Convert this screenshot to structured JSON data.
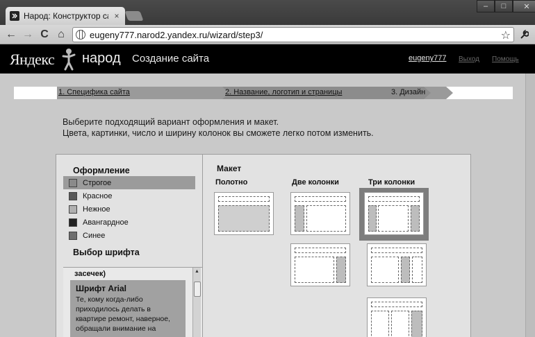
{
  "browser": {
    "tab_title": "Народ: Конструктор сайто",
    "tab_close": "×",
    "url": "eugeny777.narod2.yandex.ru/wizard/step3/",
    "window_controls": {
      "minimize": "–",
      "maximize": "□",
      "close": "✕"
    },
    "nav": {
      "back": "←",
      "forward": "→",
      "reload": "C",
      "home": "⌂",
      "star": "☆",
      "wrench": "🔧"
    }
  },
  "site": {
    "logo_yandex": "Яндекс",
    "logo_narod": "народ",
    "heading": "Создание сайта",
    "user": "eugeny777",
    "exit": "Выход",
    "help": "Помощь"
  },
  "steps": {
    "step1": "1. Специфика сайта",
    "step2": "2. Название, логотип и страницы",
    "step3": "3. Дизайн"
  },
  "intro": {
    "line1": "Выберите подходящий вариант оформления и макет.",
    "line2": "Цвета, картинки, число и ширину колонок вы сможете легко потом изменить."
  },
  "design": {
    "title": "Оформление",
    "styles": [
      {
        "label": "Строгое",
        "swatch": "#8a8a8a",
        "selected": true
      },
      {
        "label": "Красное",
        "swatch": "#5a5a5a",
        "selected": false
      },
      {
        "label": "Нежное",
        "swatch": "#b0b0b0",
        "selected": false
      },
      {
        "label": "Авангардное",
        "swatch": "#222222",
        "selected": false
      },
      {
        "label": "Синее",
        "swatch": "#6e6e6e",
        "selected": false
      }
    ]
  },
  "font": {
    "title": "Выбор шрифта",
    "tail": "засечек)",
    "card_title": "Шрифт Arial",
    "card_text": "Те, кому когда-либо приходилось делать в квартире ремонт, наверное, обращали внимание на"
  },
  "layout": {
    "title": "Макет",
    "columns": [
      "Полотно",
      "Две колонки",
      "Три колонки"
    ]
  }
}
